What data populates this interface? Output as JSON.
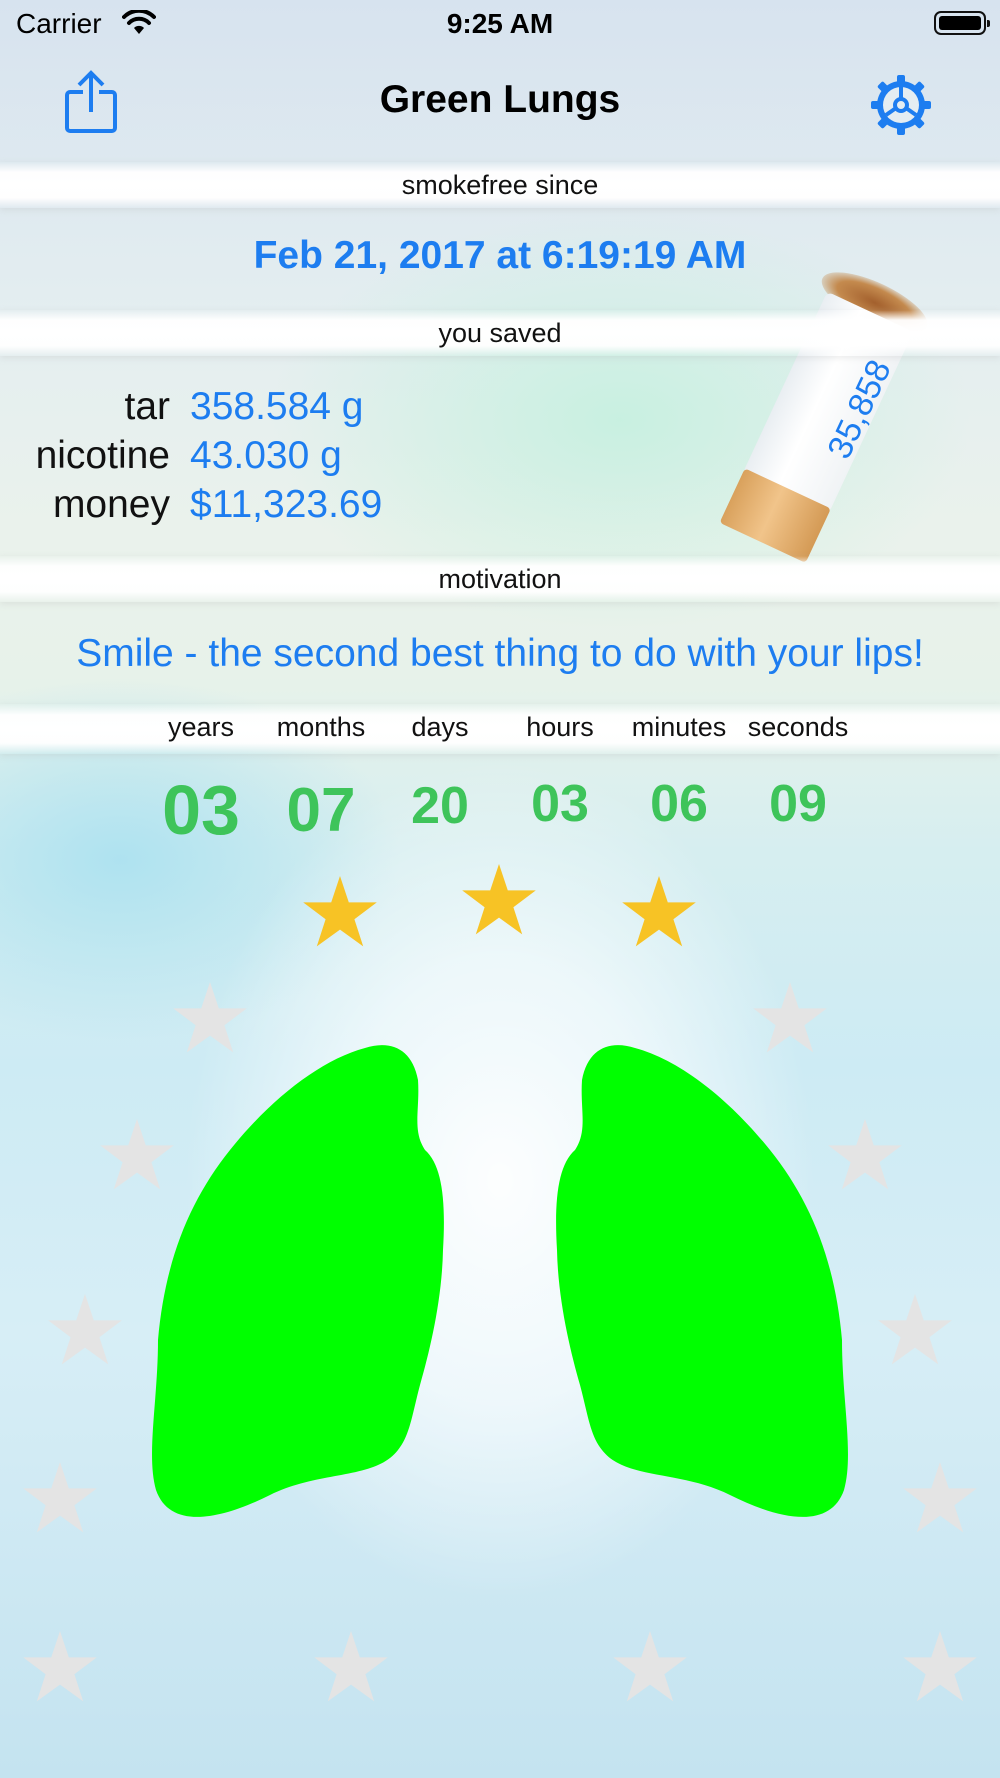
{
  "status_bar": {
    "carrier": "Carrier",
    "time": "9:25 AM"
  },
  "nav": {
    "title": "Green Lungs",
    "share_icon": "share-icon",
    "settings_icon": "gear-icon"
  },
  "sections": {
    "smokefree_since": "smokefree since",
    "you_saved": "you saved",
    "motivation": "motivation"
  },
  "smokefree_date": "Feb 21, 2017 at 6:19:19 AM",
  "saved": [
    {
      "label": "tar",
      "value": "358.584 g"
    },
    {
      "label": "nicotine",
      "value": "43.030 g"
    },
    {
      "label": "money",
      "value": "$11,323.69"
    }
  ],
  "cigarettes_not_smoked": "35,858",
  "motivation_text": "Smile - the second best thing to do with your lips!",
  "duration": {
    "labels": [
      "years",
      "months",
      "days",
      "hours",
      "minutes",
      "seconds"
    ],
    "values": [
      "03",
      "07",
      "20",
      "03",
      "06",
      "09"
    ]
  },
  "achievements": {
    "earned": 3,
    "total": 15
  },
  "colors": {
    "accent": "#1d7df0",
    "counter": "#3ec45a",
    "lungs": "#00ff00",
    "star_earned": "#f7c325",
    "star_empty": "#e4e4e4"
  }
}
